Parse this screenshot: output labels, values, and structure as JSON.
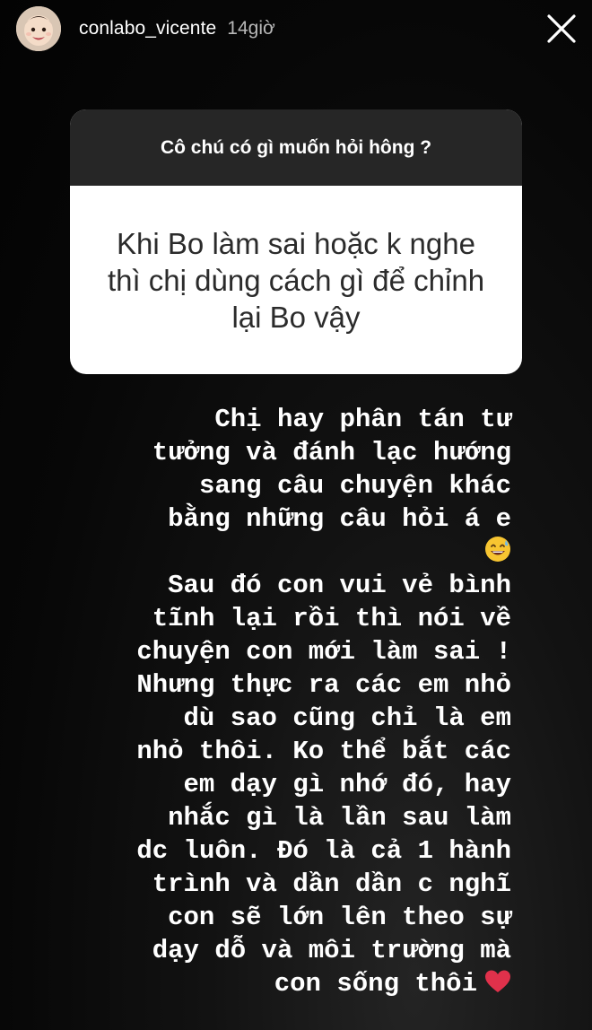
{
  "story": {
    "username": "conlabo_vicente",
    "timestamp": "14giờ",
    "avatar_icon": "baby-face-avatar",
    "close_icon": "close-icon"
  },
  "question_box": {
    "prompt": "Cô chú có gì muốn hỏi hông ?",
    "question": "Khi Bo làm sai hoặc k nghe thì chị dùng cách gì để chỉnh lại Bo vậy"
  },
  "answer": {
    "line_1": "Chị hay phân tán tư",
    "line_2": "tưởng và đánh lạc hướng",
    "line_3": "sang câu chuyện khác",
    "line_4": "bằng những câu hỏi á e",
    "emoji_1": "grinning-sweat-emoji",
    "line_5": "Sau đó con vui vẻ bình",
    "line_6": "tĩnh lại rồi thì nói về",
    "line_7": "chuyện con mới làm sai !",
    "line_8": "Nhưng thực ra các em nhỏ",
    "line_9": "dù sao cũng chỉ là em",
    "line_10": "nhỏ thôi. Ko thể bắt các",
    "line_11": "em dạy gì nhớ đó, hay",
    "line_12": "nhắc gì là lần sau làm",
    "line_13": "dc luôn. Đó là cả 1 hành",
    "line_14": "trình và dần dần c nghĩ",
    "line_15": "con sẽ lớn lên theo sự",
    "line_16": "dạy dỗ và môi trường mà",
    "line_17": "con sống thôi",
    "emoji_2": "red-heart-emoji"
  },
  "colors": {
    "question_header_bg": "#262626",
    "question_body_bg": "#ffffff",
    "text_white": "#ffffff",
    "heart_red": "#e0314b",
    "emoji_yellow": "#f7c531"
  }
}
